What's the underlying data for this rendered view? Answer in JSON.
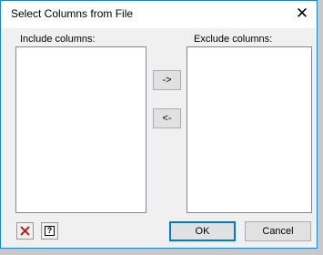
{
  "window": {
    "title": "Select Columns from File",
    "close_glyph": "✕"
  },
  "include": {
    "label": "Include columns:",
    "items": []
  },
  "exclude": {
    "label": "Exclude columns:",
    "items": []
  },
  "transfer": {
    "move_right_label": "->",
    "move_left_label": "<-"
  },
  "footer": {
    "clear_icon": "red-x-icon",
    "help_icon": "question-mark-icon",
    "help_glyph": "?",
    "ok_label": "OK",
    "cancel_label": "Cancel"
  },
  "colors": {
    "accent": "#0078d7",
    "window_border": "#1883d7",
    "clear_icon": "#c0181c"
  }
}
